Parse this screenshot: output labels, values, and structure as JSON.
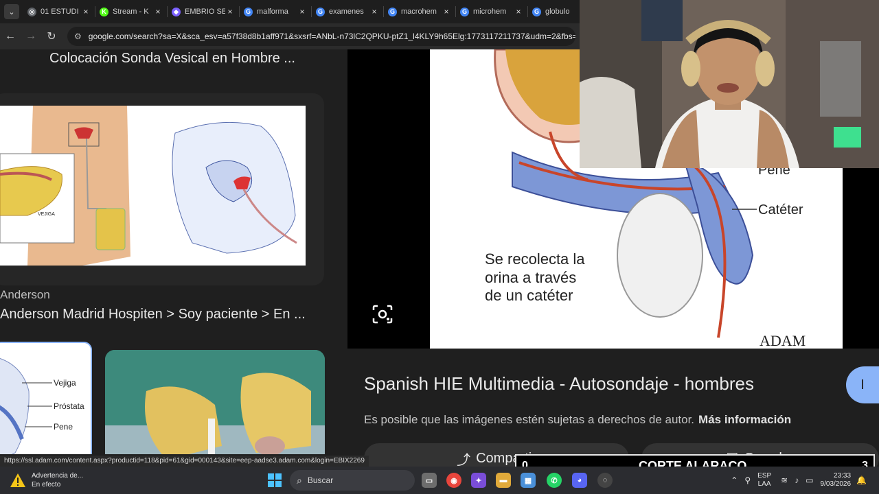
{
  "tabs": [
    {
      "title": "01 ESTUDI",
      "fav_color": "#5f6368",
      "fav_glyph": "◎"
    },
    {
      "title": "Stream - K",
      "fav_color": "#53fc18",
      "fav_glyph": "K"
    },
    {
      "title": "EMBRIO SE",
      "fav_color": "#7b61ff",
      "fav_glyph": "◆"
    },
    {
      "title": "malforma",
      "fav_color": "#4285f4",
      "fav_glyph": "G"
    },
    {
      "title": "examenes",
      "fav_color": "#4285f4",
      "fav_glyph": "G"
    },
    {
      "title": "macrohem",
      "fav_color": "#4285f4",
      "fav_glyph": "G"
    },
    {
      "title": "microhem",
      "fav_color": "#4285f4",
      "fav_glyph": "G"
    },
    {
      "title": "globulo",
      "fav_color": "#4285f4",
      "fav_glyph": "G"
    }
  ],
  "address": {
    "url": "google.com/search?sa=X&sca_esv=a57f38d8b1aff971&sxsrf=ANbL-n73lC2QPKU-ptZ1_l4KLY9h65Elg:1773117211737&udm=2&fbs=ADc"
  },
  "results": {
    "title1": "Colocación Sonda Vesical en Hombre ...",
    "thumb1_label": "VEJIGA",
    "source2": "Anderson",
    "title2": "Anderson Madrid Hospiten > Soy paciente > En ...",
    "thumb2_labels": [
      "Vejiga",
      "Próstata",
      "Pene"
    ]
  },
  "preview": {
    "image_labels": {
      "pene": "Pene",
      "cateter": "Catéter",
      "caption_line1": "Se recolecta la",
      "caption_line2": "orina a través",
      "caption_line3": "de un catéter",
      "brand": "ADAM"
    },
    "title": "Spanish HIE Multimedia - Autosondaje - hombres",
    "rights_text": "Es posible que las imágenes estén sujetas a derechos de autor.",
    "rights_link": "Más información",
    "share_label": "Compartir",
    "save_label": "Guardar"
  },
  "status_url": "https://ssl.adam.com/content.aspx?productid=118&pid=61&gid=000143&site=eep-aadse3.adam.com&login=EBIX2269",
  "overlay": {
    "left_count": "0",
    "label": "CORTE ALARACO",
    "right_count": "3"
  },
  "taskbar": {
    "weather_line1": "Advertencia de...",
    "weather_line2": "En efecto",
    "search_placeholder": "Buscar",
    "lang_line1": "ESP",
    "lang_line2": "LAA",
    "time": "23:33",
    "date": "9/03/2026"
  },
  "colors": {
    "accent": "#8ab4f8",
    "background": "#1f1f1f"
  }
}
